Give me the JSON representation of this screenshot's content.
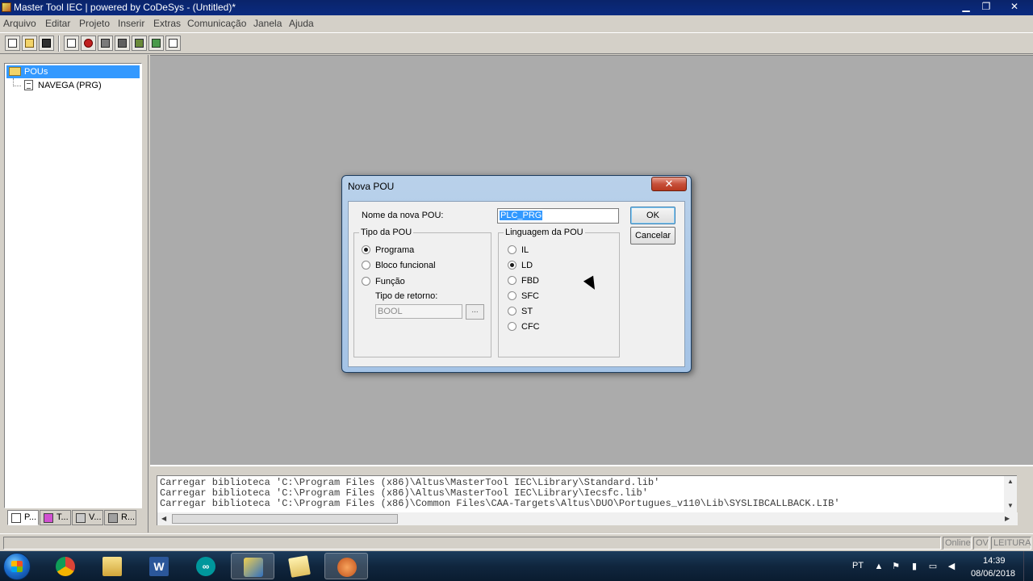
{
  "window": {
    "title": "Master Tool IEC | powered by CoDeSys - (Untitled)*",
    "minimize": "▁",
    "restore": "❐",
    "close": "✕"
  },
  "menu": {
    "items": [
      "Arquivo",
      "Editar",
      "Projeto",
      "Inserir",
      "Extras",
      "Comunicação",
      "Janela",
      "Ajuda"
    ]
  },
  "toolbar": {
    "buttons": [
      "new-icon",
      "open-icon",
      "save-icon",
      "compile-icon",
      "stop-icon",
      "login-icon",
      "logout-icon",
      "run-icon",
      "step-icon"
    ]
  },
  "tree": {
    "root": "POUs",
    "items": [
      "NAVEGA (PRG)"
    ],
    "tabs": [
      "P...",
      "T...",
      "V...",
      "R..."
    ]
  },
  "messages": [
    "Carregar biblioteca 'C:\\Program Files (x86)\\Altus\\MasterTool IEC\\Library\\Standard.lib'",
    "Carregar biblioteca 'C:\\Program Files (x86)\\Altus\\MasterTool IEC\\Library\\Iecsfc.lib'",
    "Carregar biblioteca 'C:\\Program Files (x86)\\Common Files\\CAA-Targets\\Altus\\DUO\\Portugues_v110\\Lib\\SYSLIBCALLBACK.LIB'"
  ],
  "status": {
    "online": "Online",
    "ov": "OV",
    "readonly": "LEITURA"
  },
  "dialog": {
    "title": "Nova POU",
    "close": "✕",
    "name_label": "Nome da nova POU:",
    "name_value": "PLC_PRG",
    "ok": "OK",
    "cancel": "Cancelar",
    "type_group": "Tipo da POU",
    "types": [
      {
        "label": "Programa",
        "selected": true
      },
      {
        "label": "Bloco funcional",
        "selected": false
      },
      {
        "label": "Função",
        "selected": false
      }
    ],
    "return_label": "Tipo de retorno:",
    "return_value": "BOOL",
    "return_browse": "...",
    "lang_group": "Linguagem da POU",
    "languages": [
      {
        "label": "IL",
        "selected": false
      },
      {
        "label": "LD",
        "selected": true
      },
      {
        "label": "FBD",
        "selected": false
      },
      {
        "label": "SFC",
        "selected": false
      },
      {
        "label": "ST",
        "selected": false
      },
      {
        "label": "CFC",
        "selected": false
      }
    ]
  },
  "taskbar": {
    "apps": [
      "chrome-icon",
      "explorer-icon",
      "word-icon",
      "arduino-icon",
      "mastertool-icon",
      "folder-icon",
      "app-icon"
    ],
    "lang": "PT",
    "time": "14:39",
    "date": "08/06/2018"
  },
  "colors": {
    "selection": "#3399ff",
    "workspace": "#ababab",
    "taskbar": "#10263e"
  }
}
